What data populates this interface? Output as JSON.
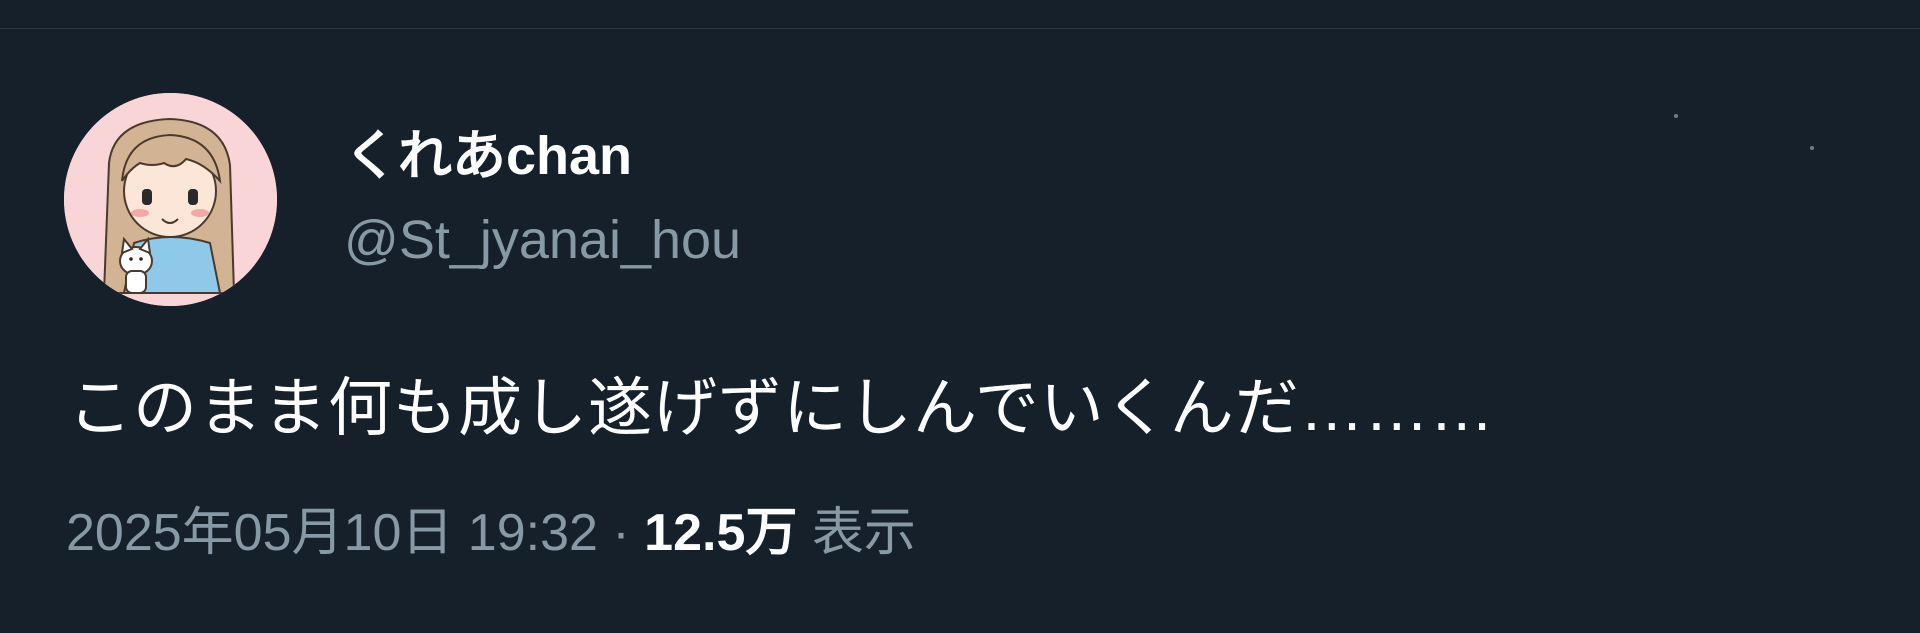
{
  "tweet": {
    "author": {
      "display_name": "くれあchan",
      "handle": "@St_jyanai_hou",
      "avatar_icon": "user-avatar-illustration"
    },
    "text": "このまま何も成し遂げずにしんでいくんだ………",
    "timestamp": "2025年05月10日 19:32",
    "separator": "·",
    "views_count": "12.5万",
    "views_label": "表示"
  },
  "colors": {
    "background": "#15202b",
    "primary_text": "#ffffff",
    "secondary_text": "#8899a6",
    "avatar_bg": "#f9d5d8"
  }
}
